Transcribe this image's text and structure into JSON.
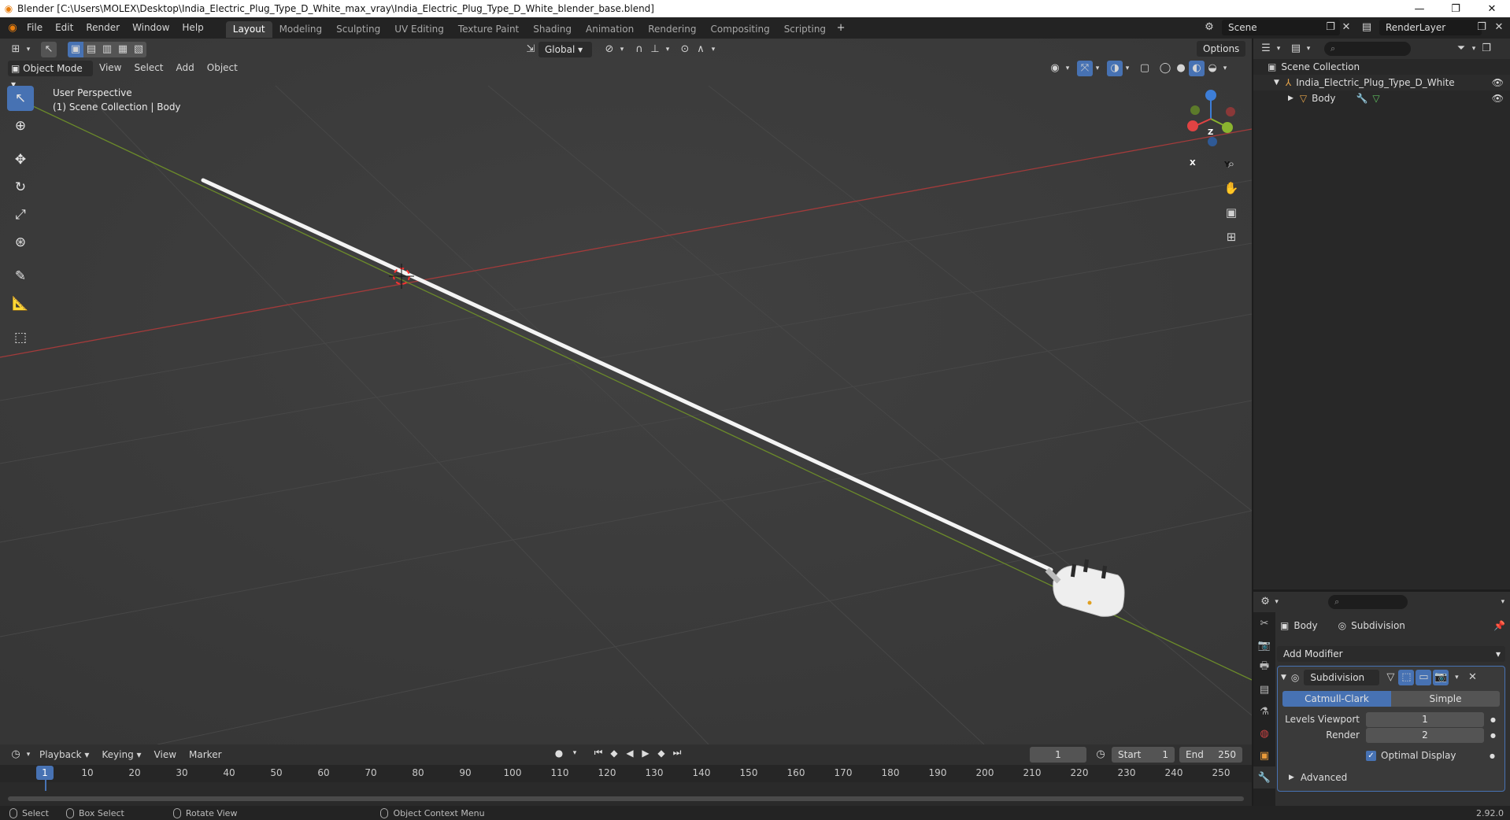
{
  "titlebar": {
    "title": "Blender [C:\\Users\\MOLEX\\Desktop\\India_Electric_Plug_Type_D_White_max_vray\\India_Electric_Plug_Type_D_White_blender_base.blend]",
    "minimize": "—",
    "restore": "❐",
    "close": "✕"
  },
  "menu": {
    "file": "File",
    "edit": "Edit",
    "render": "Render",
    "window": "Window",
    "help": "Help"
  },
  "workspaces": [
    "Layout",
    "Modeling",
    "Sculpting",
    "UV Editing",
    "Texture Paint",
    "Shading",
    "Animation",
    "Rendering",
    "Compositing",
    "Scripting"
  ],
  "scene": {
    "scene_name": "Scene",
    "view_layer": "RenderLayer"
  },
  "viewport": {
    "mode": "Object Mode",
    "view": "View",
    "select": "Select",
    "add": "Add",
    "object": "Object",
    "orientation": "Global",
    "options": "Options",
    "perspective": "User Perspective",
    "collection_info": "(1) Scene Collection | Body",
    "gizmo": {
      "z": "Z",
      "y": "Y",
      "x": "X"
    }
  },
  "outliner": {
    "root": "Scene Collection",
    "collection": "India_Electric_Plug_Type_D_White",
    "object": "Body"
  },
  "properties": {
    "object_name": "Body",
    "modifier_context": "Subdivision",
    "add_modifier": "Add Modifier",
    "modifier_name": "Subdivision",
    "catmull": "Catmull-Clark",
    "simple": "Simple",
    "levels_viewport_label": "Levels Viewport",
    "levels_viewport": "1",
    "render_label": "Render",
    "render_value": "2",
    "optimal_display": "Optimal Display",
    "advanced": "Advanced"
  },
  "timeline": {
    "playback": "Playback",
    "keying": "Keying",
    "view": "View",
    "marker": "Marker",
    "current_frame": "1",
    "start_label": "Start",
    "start": "1",
    "end_label": "End",
    "end": "250",
    "ticks": [
      "1",
      "10",
      "20",
      "30",
      "40",
      "50",
      "60",
      "70",
      "80",
      "90",
      "100",
      "110",
      "120",
      "130",
      "140",
      "150",
      "160",
      "170",
      "180",
      "190",
      "200",
      "210",
      "220",
      "230",
      "240",
      "250"
    ]
  },
  "statusbar": {
    "select": "Select",
    "box_select": "Box Select",
    "rotate_view": "Rotate View",
    "context_menu": "Object Context Menu",
    "version": "2.92.0"
  }
}
